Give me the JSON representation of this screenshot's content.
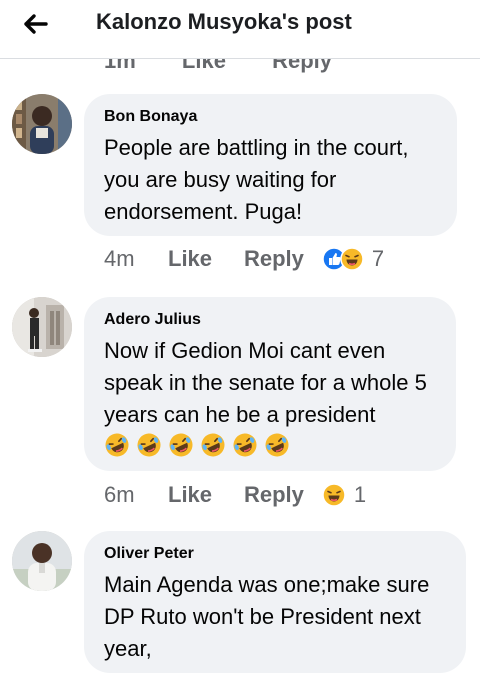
{
  "header": {
    "title": "Kalonzo Musyoka's post"
  },
  "partial_actions": {
    "time": "1m",
    "like": "Like",
    "reply": "Reply"
  },
  "comments": [
    {
      "author": "Bon Bonaya",
      "text": "People are battling in the court, you are busy waiting for endorsement. Puga!",
      "time": "4m",
      "like": "Like",
      "reply": "Reply",
      "reactions": [
        "like-reaction-icon",
        "haha-reaction-icon"
      ],
      "reaction_count": "7"
    },
    {
      "author": "Adero Julius",
      "text": "Now if Gedion Moi cant even speak in the senate for a whole 5 years can he be a president",
      "emojis": [
        "rofl-emoji",
        "rofl-emoji",
        "rofl-emoji",
        "rofl-emoji",
        "rofl-emoji",
        "rofl-emoji"
      ],
      "time": "6m",
      "like": "Like",
      "reply": "Reply",
      "reactions": [
        "haha-reaction-icon"
      ],
      "reaction_count": "1"
    },
    {
      "author": "Oliver Peter",
      "text": "Main Agenda was one;make sure DP Ruto won't be President next year,"
    }
  ],
  "colors": {
    "bubble": "#f0f2f5",
    "meta": "#65676b",
    "like_blue": "#1877f2",
    "haha_yellow": "#f7b928"
  }
}
